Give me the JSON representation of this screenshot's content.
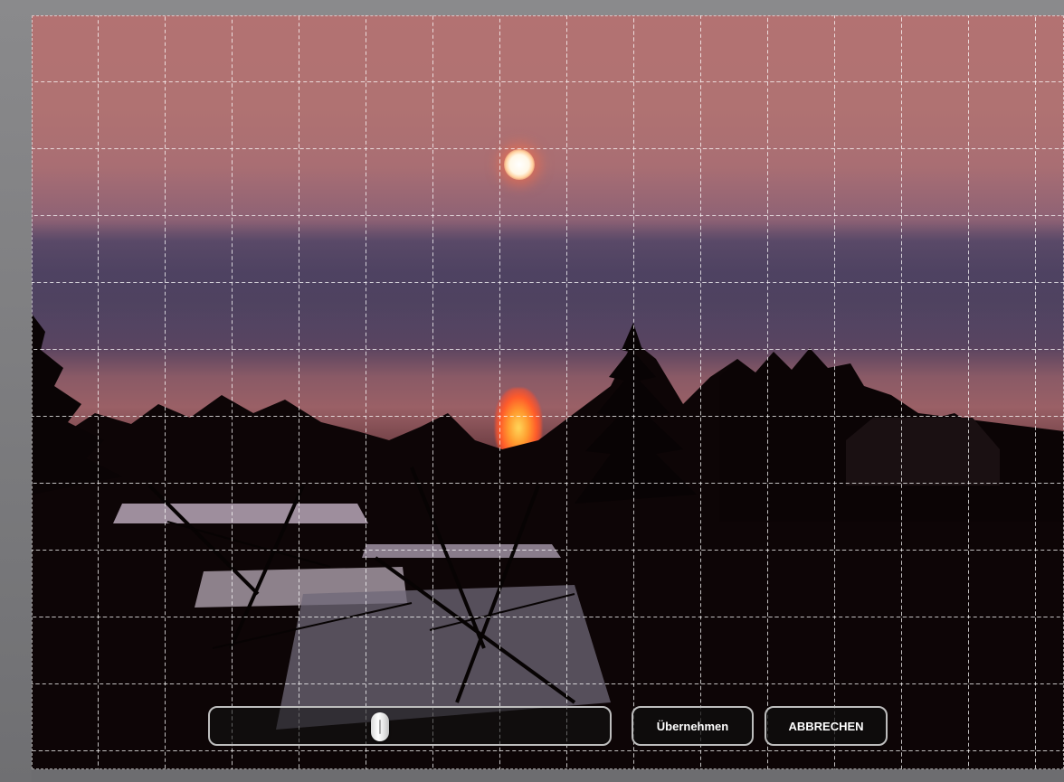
{
  "slider": {
    "value_fraction": 0.42
  },
  "buttons": {
    "apply_label": "Übernehmen",
    "cancel_label": "ABBRECHEN"
  },
  "colors": {
    "button_border": "#bdbdbd",
    "button_text": "#ffffff",
    "grid_line": "#ffffff"
  },
  "icons": {
    "slider_thumb": "slider-thumb-icon"
  }
}
